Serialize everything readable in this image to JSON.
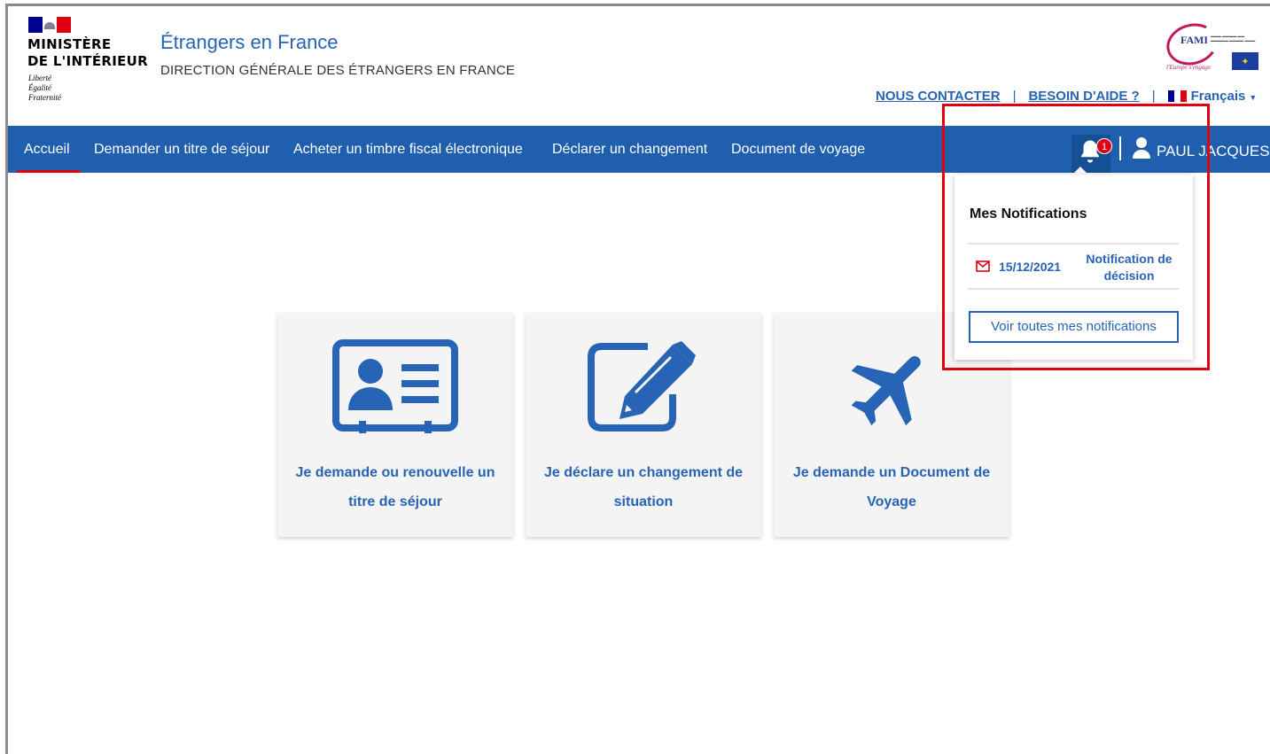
{
  "header": {
    "ministry_line1": "MINISTÈRE",
    "ministry_line2": "DE L'INTÉRIEUR",
    "devise_1": "Liberté",
    "devise_2": "Égalité",
    "devise_3": "Fraternité",
    "site_title": "Étrangers en France",
    "site_subtitle": "DIRECTION GÉNÉRALE DES ÉTRANGERS EN FRANCE",
    "fami_logo": "FAMI",
    "fami_tagline": "l'Europe s'engage",
    "contact_link": "NOUS CONTACTER",
    "help_link": "BESOIN D'AIDE ?",
    "link_separator": "|",
    "language": "Français",
    "language_flag_colors": [
      "#000091",
      "#ffffff",
      "#e1000f"
    ]
  },
  "nav": {
    "items": [
      {
        "label": "Accueil",
        "active": true
      },
      {
        "label": "Demander un titre de séjour",
        "active": false
      },
      {
        "label": "Acheter un timbre fiscal électronique",
        "active": false
      },
      {
        "label": "Déclarer un changement",
        "active": false
      },
      {
        "label": "Document de voyage",
        "active": false
      }
    ],
    "notification_count": "1",
    "user_name": "PAUL JACQUES"
  },
  "cards": [
    {
      "icon": "id-card-icon",
      "label": "Je demande ou renouvelle un titre de séjour"
    },
    {
      "icon": "edit-document-icon",
      "label": "Je déclare un changement de situation"
    },
    {
      "icon": "airplane-icon",
      "label": "Je demande un Document de Voyage"
    }
  ],
  "notifications": {
    "title": "Mes Notifications",
    "items": [
      {
        "icon": "envelope-icon",
        "date": "15/12/2021",
        "type": "Notification de décision"
      }
    ],
    "view_all": "Voir toutes mes notifications"
  },
  "colors": {
    "brand_blue": "#1f5fae",
    "link_blue": "#2764b5",
    "accent_red": "#e1000f"
  }
}
